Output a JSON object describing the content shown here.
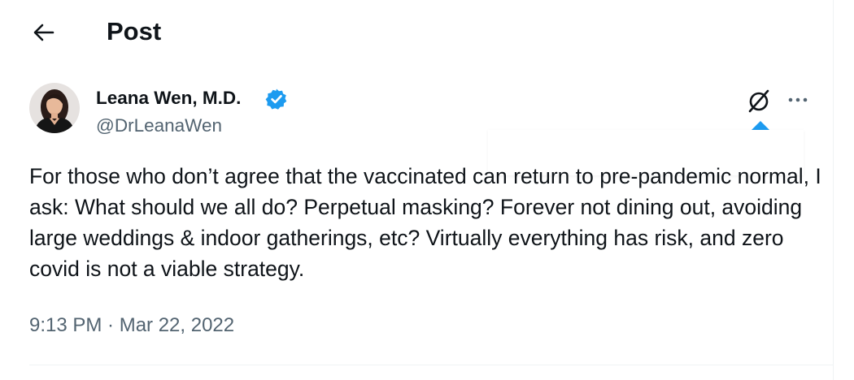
{
  "header": {
    "title": "Post",
    "back_icon": "arrow-left-icon"
  },
  "post": {
    "author": {
      "name": "Leana Wen, M.D.",
      "handle": "@DrLeanaWen",
      "verified": true,
      "badge_color": "#1d9bf0",
      "avatar_icon": "profile-photo"
    },
    "actions": {
      "grok_icon": "slashed-circle-icon",
      "more_icon": "ellipsis-icon"
    },
    "text": "For those who don’t agree that the vaccinated can return to pre-pandemic normal, I ask: What should we all do? Perpetual masking? Forever not dining out, avoiding large weddings & indoor gatherings, etc? Virtually everything has risk, and zero covid is not a viable strategy.",
    "timestamp": "9:13 PM · Mar 22, 2022"
  },
  "colors": {
    "text": "#0f1419",
    "secondary": "#536471",
    "accent": "#1d9bf0",
    "border": "#eff3f4"
  }
}
